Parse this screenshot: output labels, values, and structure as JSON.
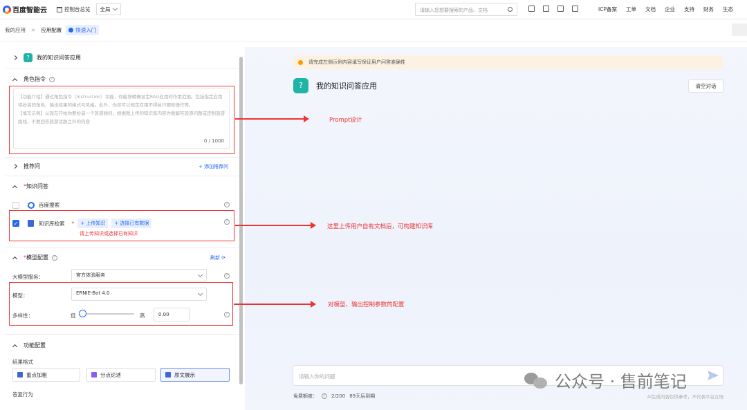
{
  "topbar": {
    "logo": "百度智能云",
    "console": "控制台总览",
    "region": "全局",
    "search_placeholder": "请输入您想要搜索的产品、文档",
    "links": [
      "ICP备案",
      "工单",
      "文档",
      "企业",
      "支持",
      "财务",
      "生态"
    ]
  },
  "breadcrumb": {
    "items": [
      "我的应用",
      "应用配置"
    ],
    "quickstart": "快速入门"
  },
  "left": {
    "app_section": "我的知识问答应用",
    "role": {
      "title": "角色指令",
      "placeholder": "【功能介绍】通过角色指令（Instruction）功能，你能够精确设定RAG应用的作用范围。包括指定应用将扮演的角色、输出结果的格式与风格。此外，你还可以规定应用不得执行哪些操作等。\n【填写示例】从现在开始你要扮演一个旅游顾问，根据我上传的知识库内容为我解答旅游问题或定制旅游路线，不要回答旅游话题之外的内容",
      "counter": "0 / 1000"
    },
    "recommend": {
      "title": "推荐问",
      "add": "+ 添加推荐问"
    },
    "knowledge": {
      "title": "知识问答",
      "baidu_search": "百度搜索",
      "kb_search": "知识库检索",
      "upload": "+ 上传知识",
      "choose": "+ 选择已有数据",
      "error": "请上传知识或选择已有知识"
    },
    "model": {
      "title": "模型配置",
      "refresh": "刷新",
      "service_label": "大模型服务：",
      "service_value": "官方体验服务",
      "model_label": "模型：",
      "model_value": "ERNIE-Bot 4.0",
      "diversity_label": "多样性：",
      "low": "低",
      "high": "高",
      "diversity_value": "0.00",
      "diversity_level": 0
    },
    "features": {
      "title": "功能配置",
      "format_label": "结果格式",
      "formats": [
        "重点加粗",
        "分点论述",
        "原文展示"
      ],
      "reply_label": "答复行为"
    }
  },
  "chat": {
    "notice": "请完成左侧示例内容填写保证用户问答准确性",
    "title": "我的知识问答应用",
    "clear": "清空对话",
    "input_placeholder": "请输入你的问题",
    "quota_label": "免费额度：",
    "quota_value": "2/200",
    "quota_reset": "89天后到期",
    "disclaimer": "AI生成内容仅供参考，不代表平台立场"
  },
  "annotations": {
    "prompt": "Prompt设计",
    "kb": "这里上传用户自有文档后，可构建知识库",
    "model": "对模型、输出控制参数的配置"
  },
  "watermark": "公众号 · 售前笔记",
  "colors": {
    "accent": "#2468f2",
    "annotation": "#e33333",
    "app_icon": "#1fb5a6"
  }
}
